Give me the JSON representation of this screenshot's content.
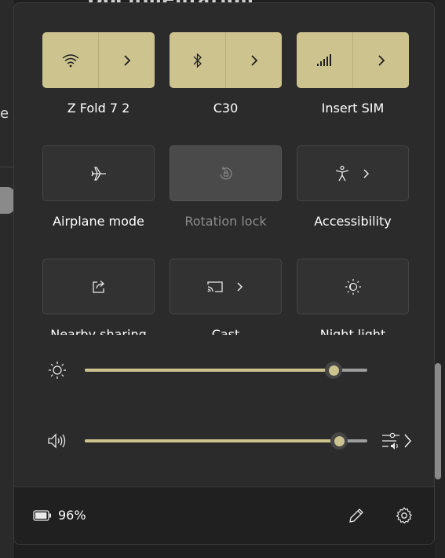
{
  "background": {
    "left_text": "e",
    "top_title": "Documentation"
  },
  "tiles_row1": [
    {
      "label": "Z Fold 7 2",
      "icon": "wifi-icon",
      "state": "on"
    },
    {
      "label": "C30",
      "icon": "bluetooth-icon",
      "state": "on"
    },
    {
      "label": "Insert SIM",
      "icon": "cellular-icon",
      "state": "on"
    }
  ],
  "tiles_row2": [
    {
      "label": "Airplane mode",
      "icon": "airplane-icon",
      "state": "off"
    },
    {
      "label": "Rotation lock",
      "icon": "rotation-lock-icon",
      "state": "disabled"
    },
    {
      "label": "Accessibility",
      "icon": "accessibility-icon",
      "state": "off"
    }
  ],
  "tiles_row3": [
    {
      "label": "Nearby sharing",
      "icon": "share-icon",
      "state": "off"
    },
    {
      "label": "Cast",
      "icon": "cast-icon",
      "state": "off"
    },
    {
      "label": "Night light",
      "icon": "night-light-icon",
      "state": "off"
    }
  ],
  "brightness": {
    "icon": "brightness-icon",
    "level": 0.88
  },
  "volume": {
    "icon": "volume-icon",
    "level": 0.9,
    "mixer_icon": "audio-mixer-icon"
  },
  "footer": {
    "battery_percent": "96%",
    "battery_level": 0.96,
    "edit_icon": "pencil-icon",
    "settings_icon": "gear-icon"
  },
  "colors": {
    "accent": "#cdc38f",
    "panel": "#2b2b2b",
    "tile_off": "#323232"
  }
}
